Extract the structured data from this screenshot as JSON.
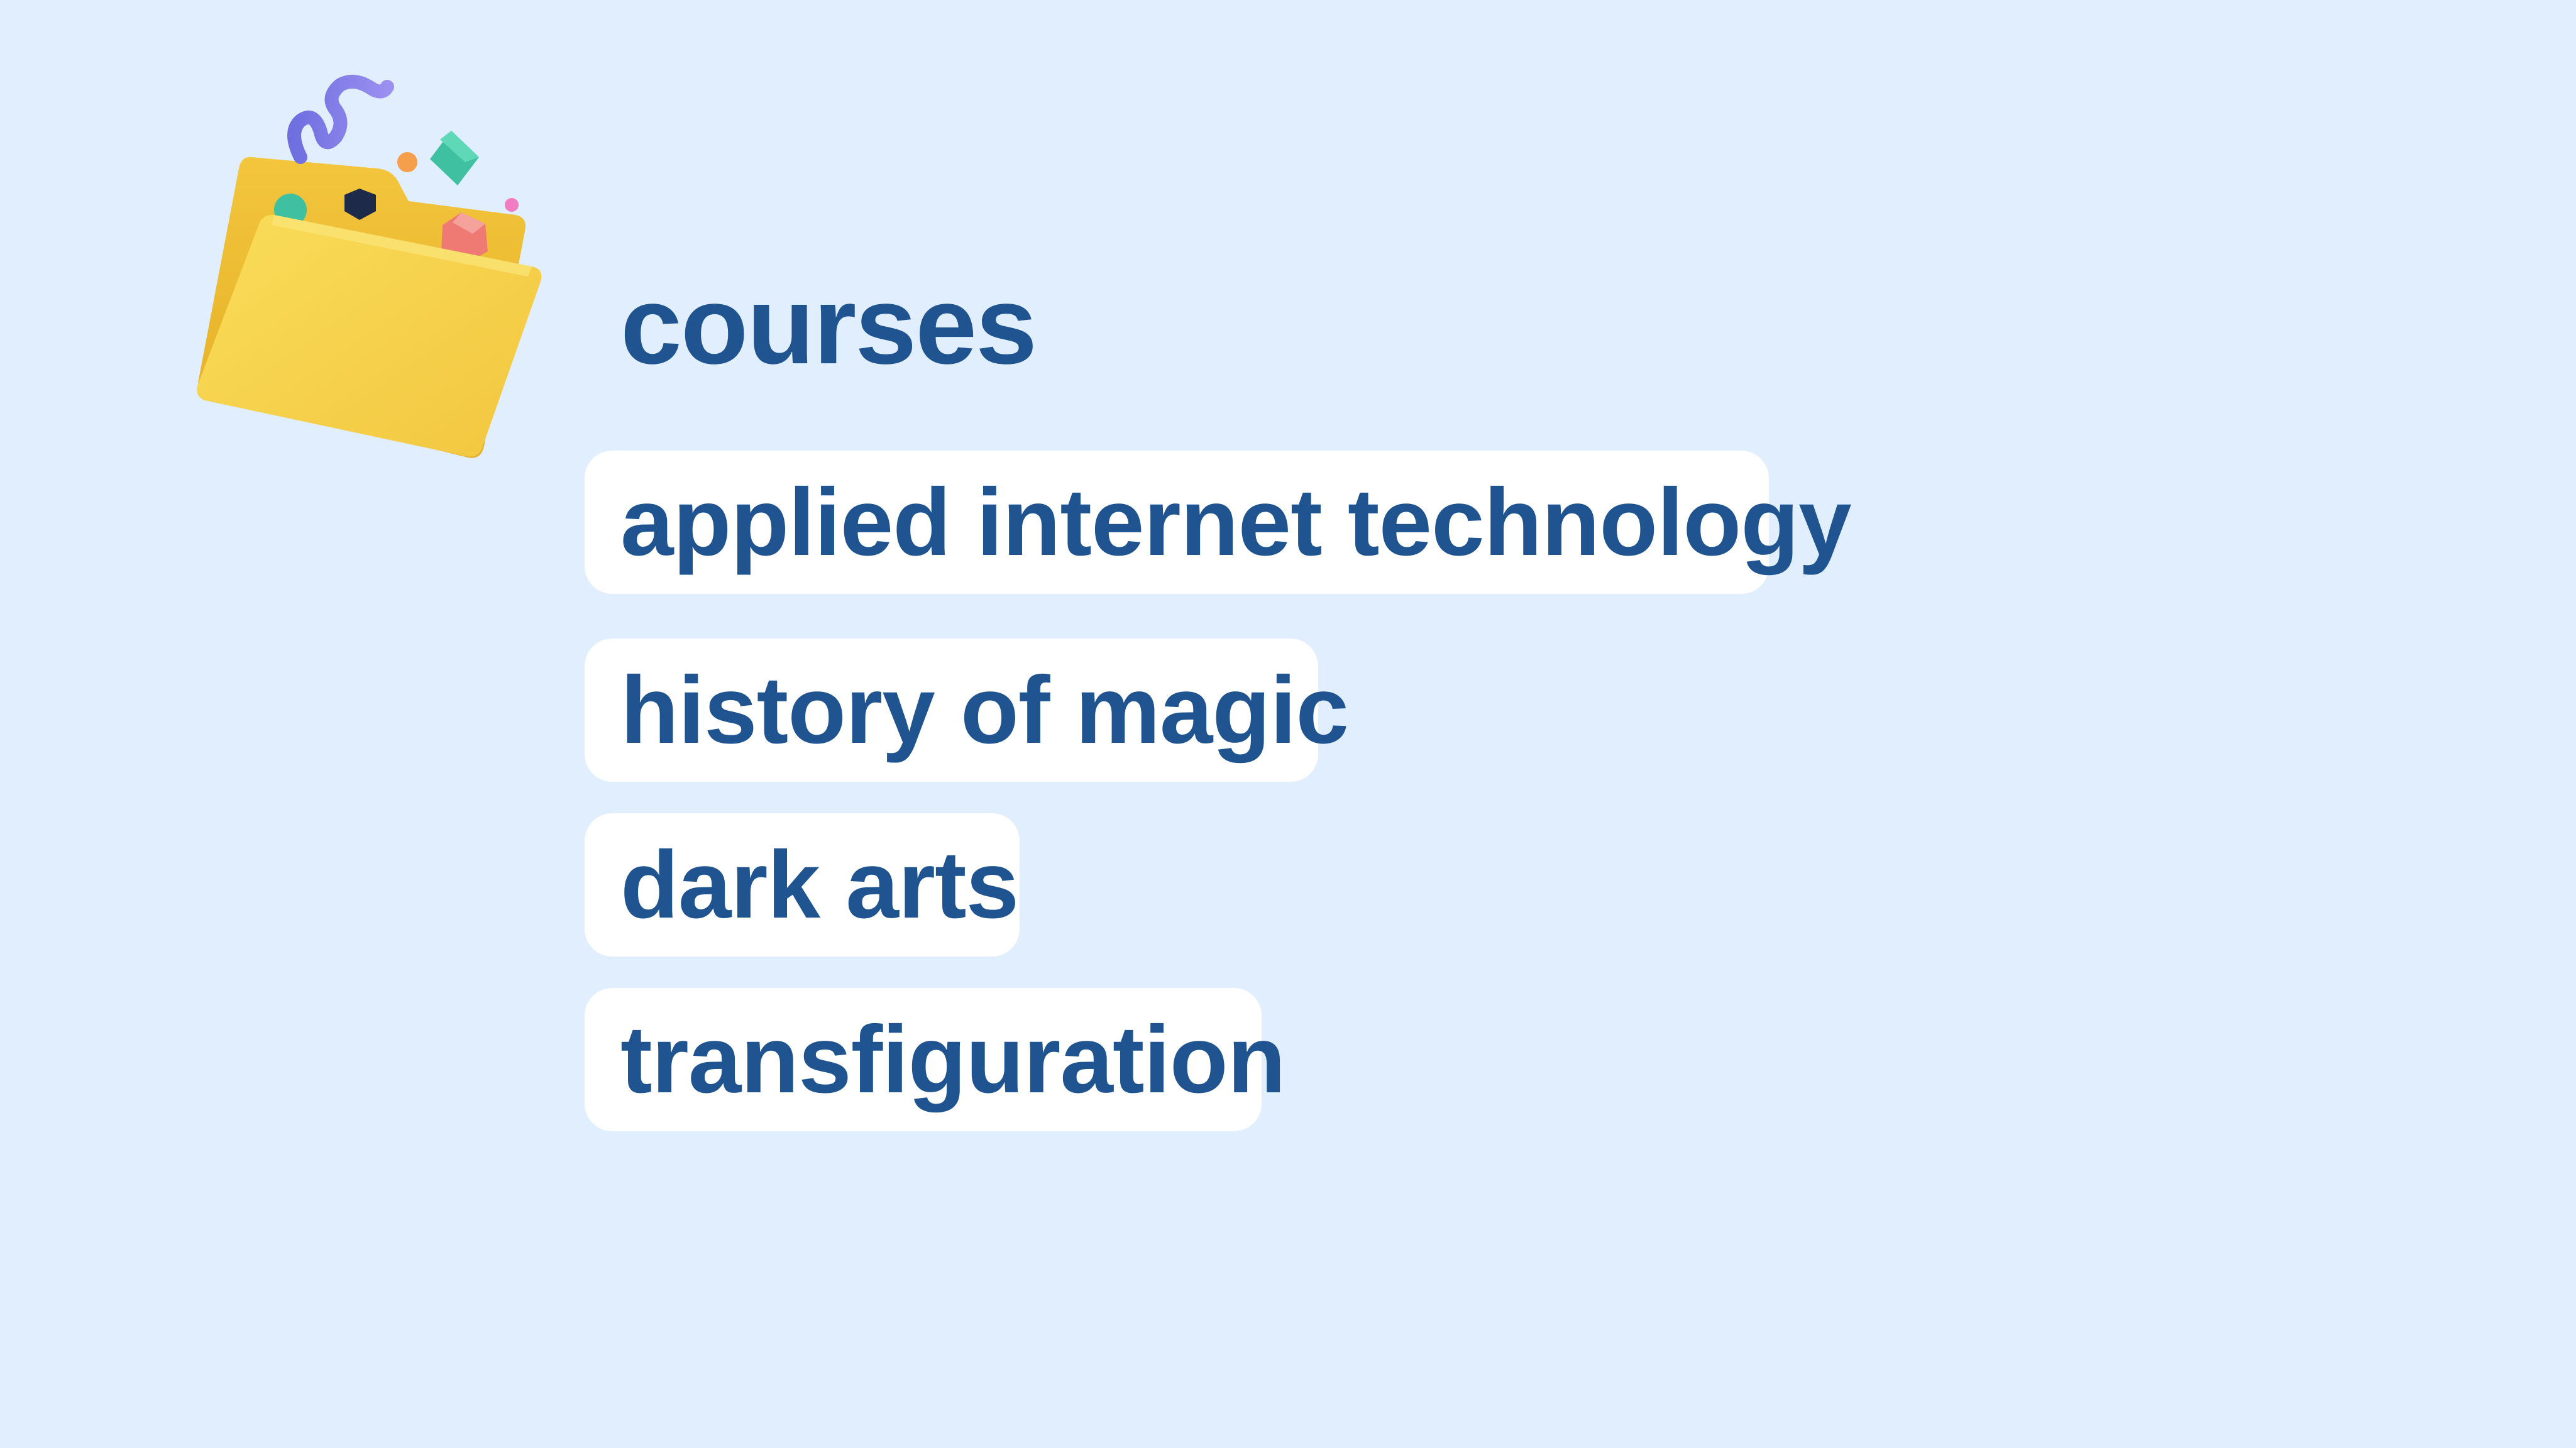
{
  "heading": "courses",
  "courses": [
    {
      "label": "applied internet technology"
    },
    {
      "label": "history of magic"
    },
    {
      "label": "dark arts"
    },
    {
      "label": "transfiguration"
    }
  ],
  "illustration": {
    "icon": "folder-icon",
    "folder_color": "#f7d24c",
    "confetti_colors": [
      "#7b7de6",
      "#f59e4b",
      "#3fc0a0",
      "#1e2a4a",
      "#ef7a73",
      "#f27cc2"
    ]
  },
  "colors": {
    "background": "#e0eefd",
    "text": "#1f5490",
    "chip": "#ffffff"
  }
}
